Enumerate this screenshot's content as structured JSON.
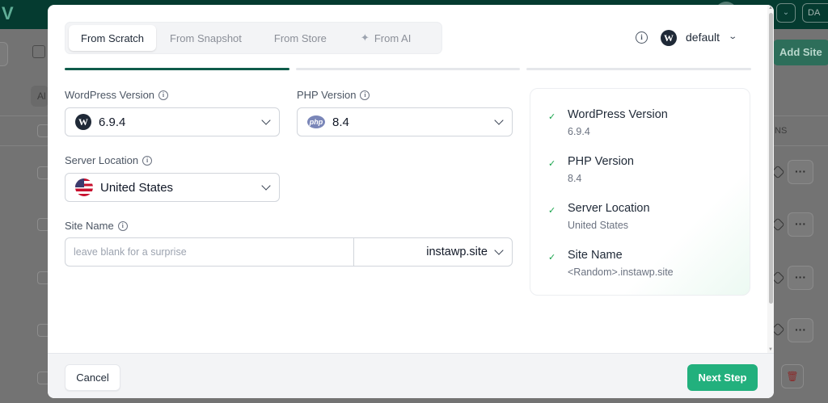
{
  "modal": {
    "tabs": [
      {
        "label": "From Scratch",
        "active": true
      },
      {
        "label": "From Snapshot",
        "active": false
      },
      {
        "label": "From Store",
        "active": false
      },
      {
        "label": "From AI",
        "active": false,
        "icon": "sparkle-icon"
      }
    ],
    "workspace": {
      "name": "default",
      "icon": "wordpress-icon"
    },
    "progress_step": 1,
    "progress_total": 3,
    "fields": {
      "wp_version": {
        "label": "WordPress Version",
        "value": "6.9.4"
      },
      "php_version": {
        "label": "PHP Version",
        "value": "8.4"
      },
      "server_location": {
        "label": "Server Location",
        "value": "United States"
      },
      "site_name": {
        "label": "Site Name",
        "placeholder": "leave blank for a surprise",
        "value": "",
        "domain": "instawp.site"
      }
    },
    "summary": [
      {
        "title": "WordPress Version",
        "value": "6.9.4"
      },
      {
        "title": "PHP Version",
        "value": "8.4"
      },
      {
        "title": "Server Location",
        "value": "United States"
      },
      {
        "title": "Site Name",
        "value": "<Random>.instawp.site"
      }
    ],
    "footer": {
      "cancel_label": "Cancel",
      "next_label": "Next Step"
    }
  },
  "background": {
    "brand_text": "V",
    "add_site_label": "Add Site",
    "filter_chip": "Al",
    "column_header_fragment": "NS",
    "user_chip": "DA",
    "more_glyph": "···",
    "trash_glyph": "🗑"
  },
  "colors": {
    "primary": "#22b07d",
    "progress_active": "#0f5c4a",
    "check": "#16a34a"
  }
}
